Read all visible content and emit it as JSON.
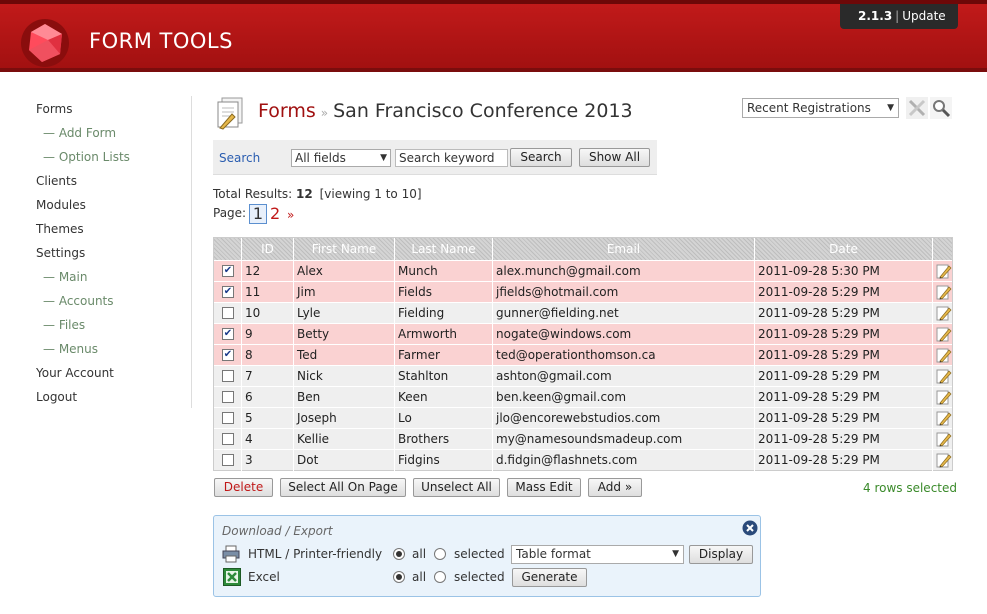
{
  "header": {
    "logo_text": "FORM TOOLS",
    "version": "2.1.3",
    "update_label": "Update"
  },
  "sidebar": {
    "items": [
      {
        "label": "Forms"
      },
      {
        "label": "— Add Form"
      },
      {
        "label": "— Option Lists"
      },
      {
        "label": "Clients"
      },
      {
        "label": "Modules"
      },
      {
        "label": "Themes"
      },
      {
        "label": "Settings"
      },
      {
        "label": "— Main"
      },
      {
        "label": "— Accounts"
      },
      {
        "label": "— Files"
      },
      {
        "label": "— Menus"
      },
      {
        "label": "Your Account"
      },
      {
        "label": "Logout"
      }
    ]
  },
  "title": {
    "forms_label": "Forms",
    "separator": "»",
    "form_name": "San Francisco Conference 2013"
  },
  "view_select": {
    "value": "Recent Registrations"
  },
  "search": {
    "label": "Search",
    "field_select": "All fields",
    "keyword_placeholder": "Search keyword",
    "search_button": "Search",
    "show_all_button": "Show All"
  },
  "results": {
    "prefix": "Total Results:",
    "total": "12",
    "viewing": "[viewing 1 to 10]",
    "page_label": "Page:",
    "current_page": "1",
    "next_page": "2",
    "next_arrow": "»"
  },
  "table": {
    "columns": [
      "ID",
      "First Name",
      "Last Name",
      "Email",
      "Date"
    ],
    "rows": [
      {
        "checked": true,
        "id": "12",
        "first": "Alex",
        "last": "Munch",
        "email": "alex.munch@gmail.com",
        "date": "2011-09-28 5:30 PM"
      },
      {
        "checked": true,
        "id": "11",
        "first": "Jim",
        "last": "Fields",
        "email": "jfields@hotmail.com",
        "date": "2011-09-28 5:29 PM"
      },
      {
        "checked": false,
        "id": "10",
        "first": "Lyle",
        "last": "Fielding",
        "email": "gunner@fielding.net",
        "date": "2011-09-28 5:29 PM"
      },
      {
        "checked": true,
        "id": "9",
        "first": "Betty",
        "last": "Armworth",
        "email": "nogate@windows.com",
        "date": "2011-09-28 5:29 PM"
      },
      {
        "checked": true,
        "id": "8",
        "first": "Ted",
        "last": "Farmer",
        "email": "ted@operationthomson.ca",
        "date": "2011-09-28 5:29 PM"
      },
      {
        "checked": false,
        "id": "7",
        "first": "Nick",
        "last": "Stahlton",
        "email": "ashton@gmail.com",
        "date": "2011-09-28 5:29 PM"
      },
      {
        "checked": false,
        "id": "6",
        "first": "Ben",
        "last": "Keen",
        "email": "ben.keen@gmail.com",
        "date": "2011-09-28 5:29 PM"
      },
      {
        "checked": false,
        "id": "5",
        "first": "Joseph",
        "last": "Lo",
        "email": "jlo@encorewebstudios.com",
        "date": "2011-09-28 5:29 PM"
      },
      {
        "checked": false,
        "id": "4",
        "first": "Kellie",
        "last": "Brothers",
        "email": "my@namesoundsmadeup.com",
        "date": "2011-09-28 5:29 PM"
      },
      {
        "checked": false,
        "id": "3",
        "first": "Dot",
        "last": "Fidgins",
        "email": "d.fidgin@flashnets.com",
        "date": "2011-09-28 5:29 PM"
      }
    ]
  },
  "actions": {
    "delete": "Delete",
    "select_all": "Select All On Page",
    "unselect_all": "Unselect All",
    "mass_edit": "Mass Edit",
    "add": "Add »",
    "rows_selected": "4 rows selected"
  },
  "export": {
    "title": "Download / Export",
    "html_label": "HTML / Printer-friendly",
    "excel_label": "Excel",
    "all_label": "all",
    "selected_label": "selected",
    "format_value": "Table format",
    "display_button": "Display",
    "generate_button": "Generate"
  },
  "colors": {
    "brand_red": "#a01010",
    "selected_row": "#fad2d2",
    "link_blue": "#2a5db0",
    "status_green": "#3a8a2a"
  }
}
